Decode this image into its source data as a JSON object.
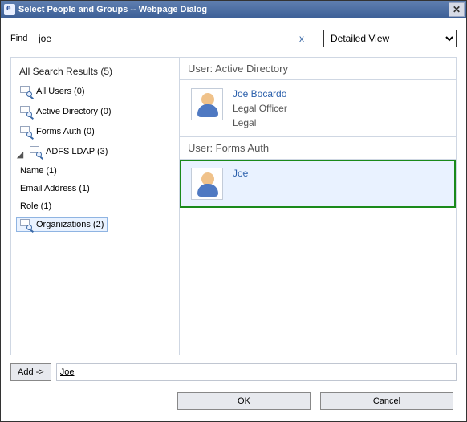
{
  "title": "Select People and Groups -- Webpage Dialog",
  "find": {
    "label": "Find",
    "value": "joe",
    "clear_icon": "x"
  },
  "view": {
    "selected": "Detailed View"
  },
  "tree": {
    "root": {
      "label": "All Search Results (5)"
    },
    "all_users": {
      "label": "All Users (0)"
    },
    "active_directory": {
      "label": "Active Directory (0)"
    },
    "forms_auth": {
      "label": "Forms Auth (0)"
    },
    "adfs_ldap": {
      "label": "ADFS LDAP (3)",
      "expanded": true
    },
    "name": {
      "label": "Name (1)"
    },
    "email": {
      "label": "Email Address (1)"
    },
    "role": {
      "label": "Role (1)"
    },
    "orgs": {
      "label": "Organizations (2)",
      "selected": true
    }
  },
  "groups": {
    "ad": {
      "header": "User: Active Directory",
      "user": {
        "name": "Joe Bocardo",
        "title": "Legal Officer",
        "dept": "Legal"
      }
    },
    "forms": {
      "header": "User: Forms Auth",
      "user": {
        "name": "Joe"
      }
    }
  },
  "add": {
    "button": "Add ->",
    "value": "Joe"
  },
  "footer": {
    "ok": "OK",
    "cancel": "Cancel"
  }
}
